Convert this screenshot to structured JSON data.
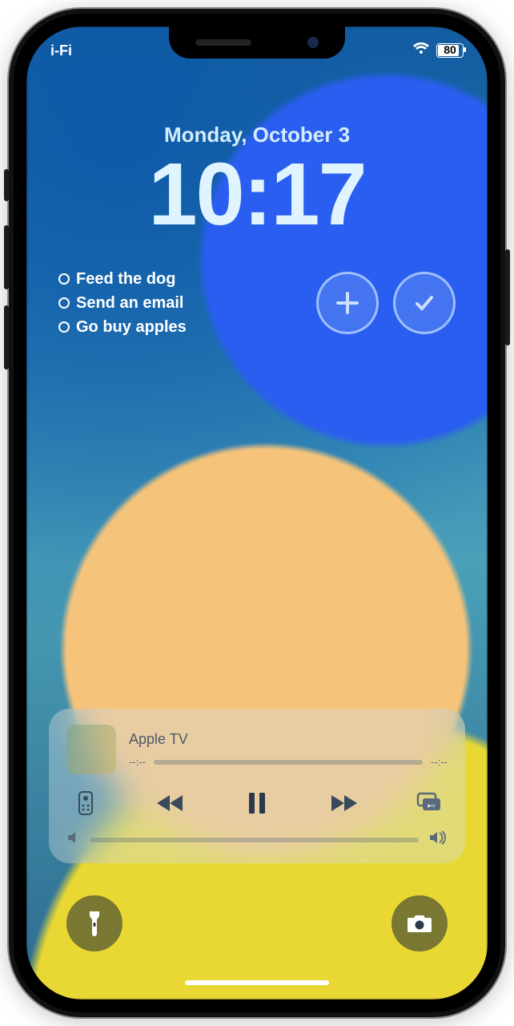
{
  "status": {
    "carrier_fragment": "i-Fi",
    "battery_pct": "80"
  },
  "datetime": {
    "date": "Monday, October 3",
    "time": "10:17"
  },
  "widgets": {
    "todo_items": [
      "Feed the dog",
      "Send an email",
      "Go buy apples"
    ]
  },
  "player": {
    "source": "Apple TV",
    "time_elapsed": "--:--",
    "time_remaining": "--:--"
  }
}
